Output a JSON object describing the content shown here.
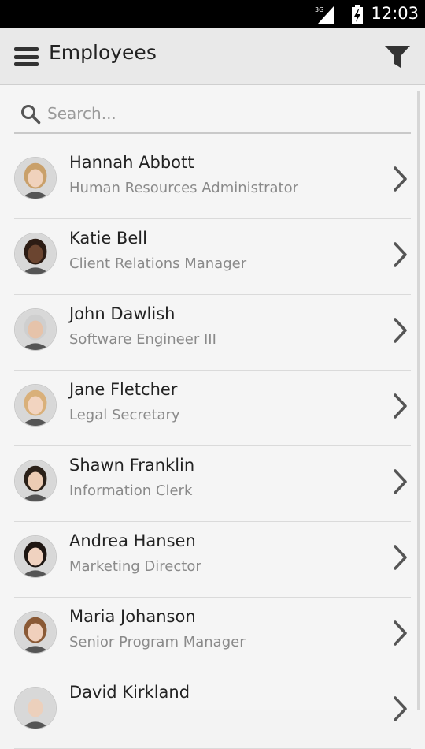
{
  "status_bar": {
    "network_label": "3G",
    "time": "12:03"
  },
  "app_bar": {
    "title": "Employees",
    "menu_icon": "hamburger-menu-icon",
    "filter_icon": "filter-funnel-icon"
  },
  "search": {
    "placeholder": "Search...",
    "value": "",
    "icon": "search-icon"
  },
  "employees": [
    {
      "name": "Hannah Abbott",
      "title": "Human Resources Administrator",
      "skin": "#f0d2bc",
      "hair": "#c9a06a"
    },
    {
      "name": "Katie Bell",
      "title": "Client Relations Manager",
      "skin": "#6b4530",
      "hair": "#2c1c14"
    },
    {
      "name": "John Dawlish",
      "title": "Software Engineer III",
      "skin": "#e6c3aa",
      "hair": "#cfcfcf"
    },
    {
      "name": "Jane Fletcher",
      "title": "Legal Secretary",
      "skin": "#f2d4c0",
      "hair": "#d9b07a"
    },
    {
      "name": "Shawn Franklin",
      "title": "Information Clerk",
      "skin": "#ecccb4",
      "hair": "#2a2018"
    },
    {
      "name": "Andrea Hansen",
      "title": "Marketing Director",
      "skin": "#f0d2c0",
      "hair": "#1e1612"
    },
    {
      "name": "Maria Johanson",
      "title": "Senior Program Manager",
      "skin": "#f0d0bc",
      "hair": "#8a5a36"
    },
    {
      "name": "David Kirkland",
      "title": "",
      "skin": "#ecd0bc",
      "hair": "#d8d8d8"
    }
  ],
  "list_item_chevron_icon": "chevron-right-icon"
}
